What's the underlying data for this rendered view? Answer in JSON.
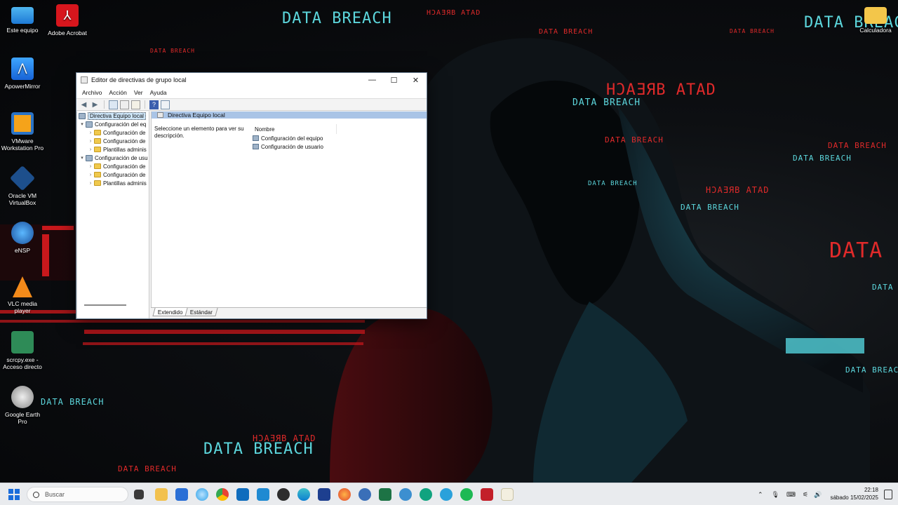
{
  "desktop": {
    "icons": [
      {
        "label": "Este equipo"
      },
      {
        "label": "Adobe Acrobat"
      },
      {
        "label": "ApowerMirror"
      },
      {
        "label": "VMware Workstation Pro"
      },
      {
        "label": "Oracle VM VirtualBox"
      },
      {
        "label": "eNSP"
      },
      {
        "label": "VLC media player"
      },
      {
        "label": "scrcpy.exe - Acceso directo"
      },
      {
        "label": "Google Earth Pro"
      },
      {
        "label": "Calculadora"
      }
    ]
  },
  "wallpaper": {
    "big_text": "DATA BREACH",
    "mirror_text": "HƆAƎЯB ATAD",
    "partial_text": "DATA"
  },
  "window": {
    "title": "Editor de directivas de grupo local",
    "controls": {
      "minimize": "—",
      "maximize": "☐",
      "close": "✕"
    },
    "menu": [
      "Archivo",
      "Acción",
      "Ver",
      "Ayuda"
    ],
    "tree": [
      {
        "label": "Directiva Equipo local",
        "level": 0,
        "arrow": ""
      },
      {
        "label": "Configuración del eq",
        "level": 1,
        "arrow": "▾"
      },
      {
        "label": "Configuración de",
        "level": 2,
        "arrow": "›"
      },
      {
        "label": "Configuración de",
        "level": 2,
        "arrow": "›"
      },
      {
        "label": "Plantillas adminis",
        "level": 2,
        "arrow": "›"
      },
      {
        "label": "Configuración de usu",
        "level": 1,
        "arrow": "▾"
      },
      {
        "label": "Configuración de",
        "level": 2,
        "arrow": "›"
      },
      {
        "label": "Configuración de",
        "level": 2,
        "arrow": "›"
      },
      {
        "label": "Plantillas adminis",
        "level": 2,
        "arrow": "›"
      }
    ],
    "content_header": "Directiva Equipo local",
    "description": "Seleccione un elemento para ver su descripción.",
    "list_column": "Nombre",
    "list_items": [
      "Configuración del equipo",
      "Configuración de usuario"
    ],
    "tabs": [
      "Extendido",
      "Estándar"
    ]
  },
  "taskbar": {
    "search_placeholder": "Buscar",
    "time": "22:18",
    "date": "sábado 15/02/2025",
    "chevron": "⌃"
  }
}
